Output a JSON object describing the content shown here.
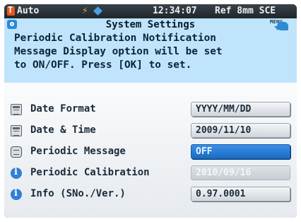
{
  "status_bar": {
    "mode": "Auto",
    "time": "12:34:07",
    "mode_info": "Ref 8mm SCE",
    "icons": [
      "auto-mode-icon",
      "flash-icon",
      "sensor-icon"
    ]
  },
  "header": {
    "title": "System Settings",
    "menu_label": "MENU",
    "icons": [
      "settings-icon",
      "back-arrow-icon"
    ]
  },
  "notification": {
    "lines": [
      "Periodic Calibration Notification",
      "Message Display option will be set",
      "to ON/OFF. Press [OK] to set."
    ]
  },
  "settings": [
    {
      "label": "Date Format",
      "value": "YYYY/MM/DD",
      "icon": "calendar-icon",
      "state": "normal"
    },
    {
      "label": "Date & Time",
      "value": "2009/11/10",
      "icon": "calendar-icon",
      "state": "normal"
    },
    {
      "label": "Periodic Message",
      "value": "OFF",
      "icon": "message-icon",
      "state": "selected"
    },
    {
      "label": "Periodic Calibration",
      "value": "2010/09/16",
      "icon": "info-icon",
      "state": "disabled"
    },
    {
      "label": "Info (SNo./Ver.)",
      "value": "0.97.0001",
      "icon": "info-icon",
      "state": "normal"
    }
  ],
  "colors": {
    "header_bg": "#bfe4fb",
    "selected": "#1b6cc4",
    "status_bg": "#1f262c"
  }
}
